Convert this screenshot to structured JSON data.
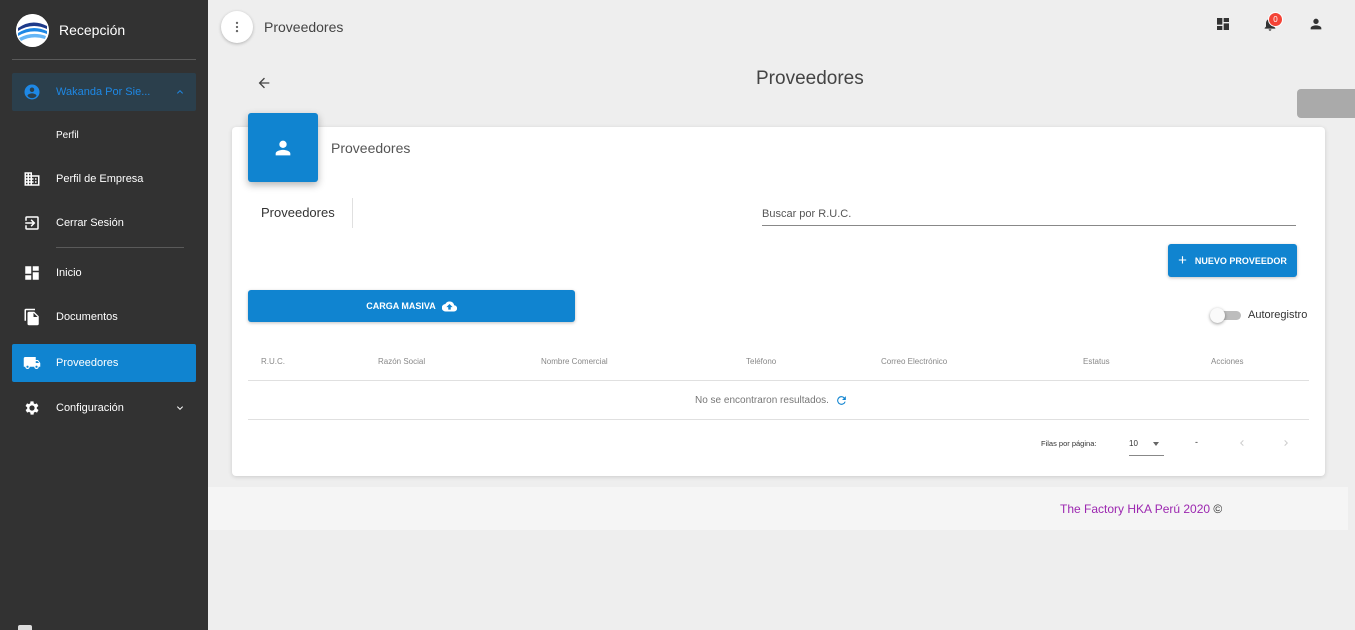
{
  "sidebar": {
    "brand": "Recepción",
    "user": "Wakanda Por Sie...",
    "items": [
      {
        "label": "Perfil"
      },
      {
        "label": "Perfil de Empresa"
      },
      {
        "label": "Cerrar Sesión"
      },
      {
        "label": "Inicio"
      },
      {
        "label": "Documentos"
      },
      {
        "label": "Proveedores"
      },
      {
        "label": "Configuración"
      }
    ]
  },
  "topbar": {
    "title": "Proveedores",
    "notifications": "0"
  },
  "page": {
    "heading": "Proveedores"
  },
  "card": {
    "title": "Proveedores",
    "tab": "Proveedores",
    "search_placeholder": "Buscar por R.U.C.",
    "new_button": "NUEVO PROVEEDOR",
    "mass_button": "CARGA MASIVA",
    "toggle_label": "Autoregistro",
    "columns": [
      "R.U.C.",
      "Razón Social",
      "Nombre Comercial",
      "Teléfono",
      "Correo Electrónico",
      "Estatus",
      "Acciones"
    ],
    "empty_message": "No se encontraron resultados.",
    "rows_per_page_label": "Filas por página:",
    "rows_per_page_value": "10",
    "range": "-"
  },
  "footer": {
    "text": "The Factory HKA Perú 2020",
    "copyright": "©"
  },
  "colors": {
    "sidebar": "#323232",
    "primary": "#1084d0",
    "footer_text": "#9c27b0",
    "badge": "#f44336"
  },
  "icons": {
    "user": "account-circle-icon",
    "company": "building-icon",
    "logout": "exit-icon",
    "home": "dashboard-icon",
    "documents": "document-icon",
    "suppliers": "truck-icon",
    "settings": "gear-icon"
  }
}
